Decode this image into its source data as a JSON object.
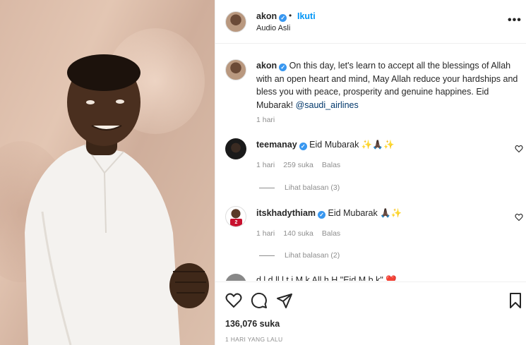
{
  "post": {
    "username": "akon",
    "follow_label": "Ikuti",
    "dot": "•",
    "audio": "Audio Asli",
    "more": "•••"
  },
  "caption": {
    "username": "akon",
    "text": "On this day, let's learn to accept all the blessings of Allah with an open heart and mind, May Allah reduce your hardships and bless you with peace, prosperity and genuine happines. Eid Mubarak!",
    "mention": "@saudi_airlines",
    "time": "1 hari"
  },
  "comments": [
    {
      "username": "teemanay",
      "text": "Eid Mubarak ✨🙏🏿✨",
      "time": "1 hari",
      "likes": "259 suka",
      "reply": "Balas",
      "view_replies": "Lihat balasan (3)"
    },
    {
      "username": "itskhadythiam",
      "text": "Eid Mubarak 🙏🏿✨",
      "time": "1 hari",
      "likes": "140 suka",
      "reply": "Balas",
      "view_replies": "Lihat balasan (2)"
    }
  ],
  "partial_comment": "d l    d ll   l  t  i    M  k  All h H            \"Eid M b  k\"  ❤️",
  "footer": {
    "likes": "136,076 suka",
    "time_ago": "1 HARI YANG LALU"
  },
  "colors": {
    "link_blue": "#0095f6",
    "verified_blue": "#3897f0",
    "muted_text": "#8e8e8e"
  },
  "icons": [
    "heart-icon",
    "comment-icon",
    "share-icon",
    "bookmark-icon",
    "more-icon",
    "verified-icon"
  ]
}
